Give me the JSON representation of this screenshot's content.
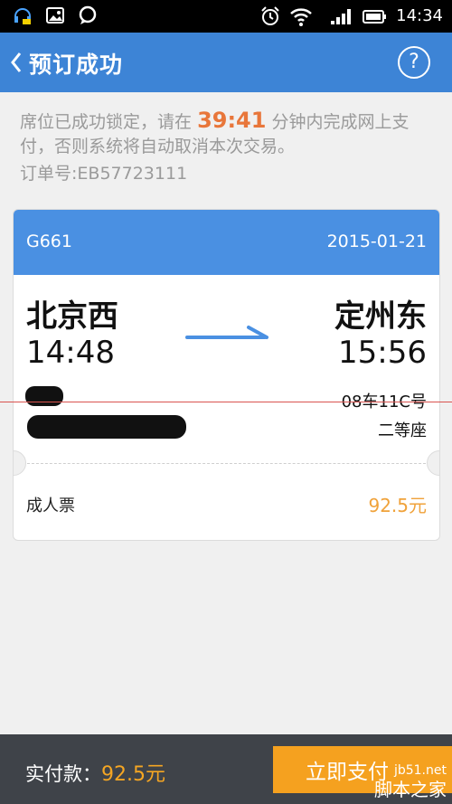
{
  "status_bar": {
    "time": "14:34",
    "icons_left": [
      "headset-icon",
      "image-icon",
      "chat-icon"
    ],
    "icons_right": [
      "alarm-icon",
      "wifi-icon",
      "signal-icon",
      "battery-icon"
    ]
  },
  "header": {
    "title": "预订成功",
    "help_label": "?"
  },
  "notice": {
    "text_before": "席位已成功锁定，请在",
    "countdown": "39:41",
    "text_after": "分钟内完成网上支付，否则系统将自动取消本次交易。",
    "order_label": "订单号:",
    "order_no": "EB57723111"
  },
  "ticket": {
    "train_no": "G661",
    "date": "2015-01-21",
    "from_station": "北京西",
    "to_station": "定州东",
    "depart_time": "14:48",
    "arrive_time": "15:56",
    "seat": "08车11C号",
    "seat_class": "二等座",
    "ticket_type": "成人票",
    "price": "92.5元"
  },
  "footer": {
    "pay_label": "实付款：",
    "pay_amount": "92.5元",
    "pay_button": "立即支付"
  },
  "watermark": {
    "site": "jb51.net",
    "name": "脚本之家"
  },
  "colors": {
    "primary": "#3d84d6",
    "accent": "#f5a11f",
    "countdown": "#e8763a"
  }
}
